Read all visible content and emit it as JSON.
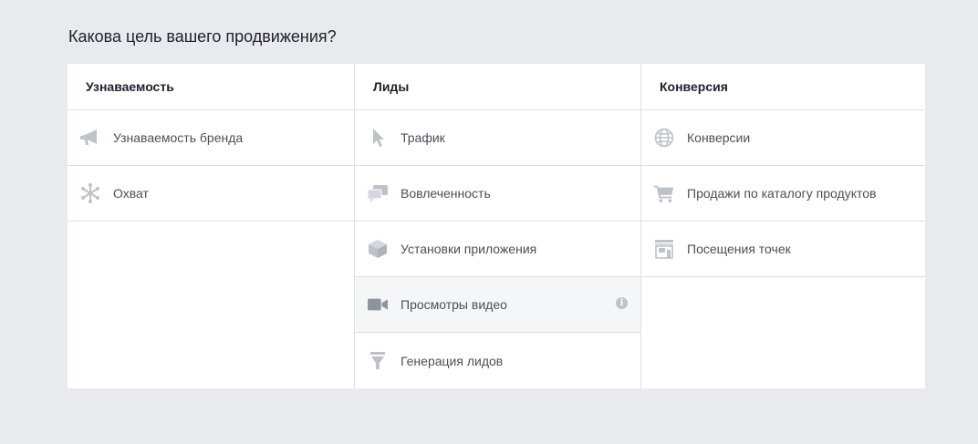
{
  "question": "Какова цель вашего продвижения?",
  "columns": [
    {
      "header": "Узнаваемость",
      "items": [
        {
          "label": "Узнаваемость бренда",
          "icon": "megaphone-icon"
        },
        {
          "label": "Охват",
          "icon": "reach-icon"
        }
      ]
    },
    {
      "header": "Лиды",
      "items": [
        {
          "label": "Трафик",
          "icon": "cursor-icon"
        },
        {
          "label": "Вовлеченность",
          "icon": "chat-bubbles-icon"
        },
        {
          "label": "Установки приложения",
          "icon": "box-icon"
        },
        {
          "label": "Просмотры видео",
          "icon": "video-camera-icon",
          "selected": true,
          "info": "i"
        },
        {
          "label": "Генерация лидов",
          "icon": "funnel-icon"
        }
      ]
    },
    {
      "header": "Конверсия",
      "items": [
        {
          "label": "Конверсии",
          "icon": "globe-icon"
        },
        {
          "label": "Продажи по каталогу продуктов",
          "icon": "shopping-cart-icon"
        },
        {
          "label": "Посещения точек",
          "icon": "store-icon"
        }
      ]
    }
  ],
  "colors": {
    "background": "#e9eaed",
    "panel": "#ffffff",
    "border": "#dddfe2",
    "icon": "#bec2c9",
    "icon_selected": "#8d949e",
    "selected_bg": "#f5f6f7"
  }
}
